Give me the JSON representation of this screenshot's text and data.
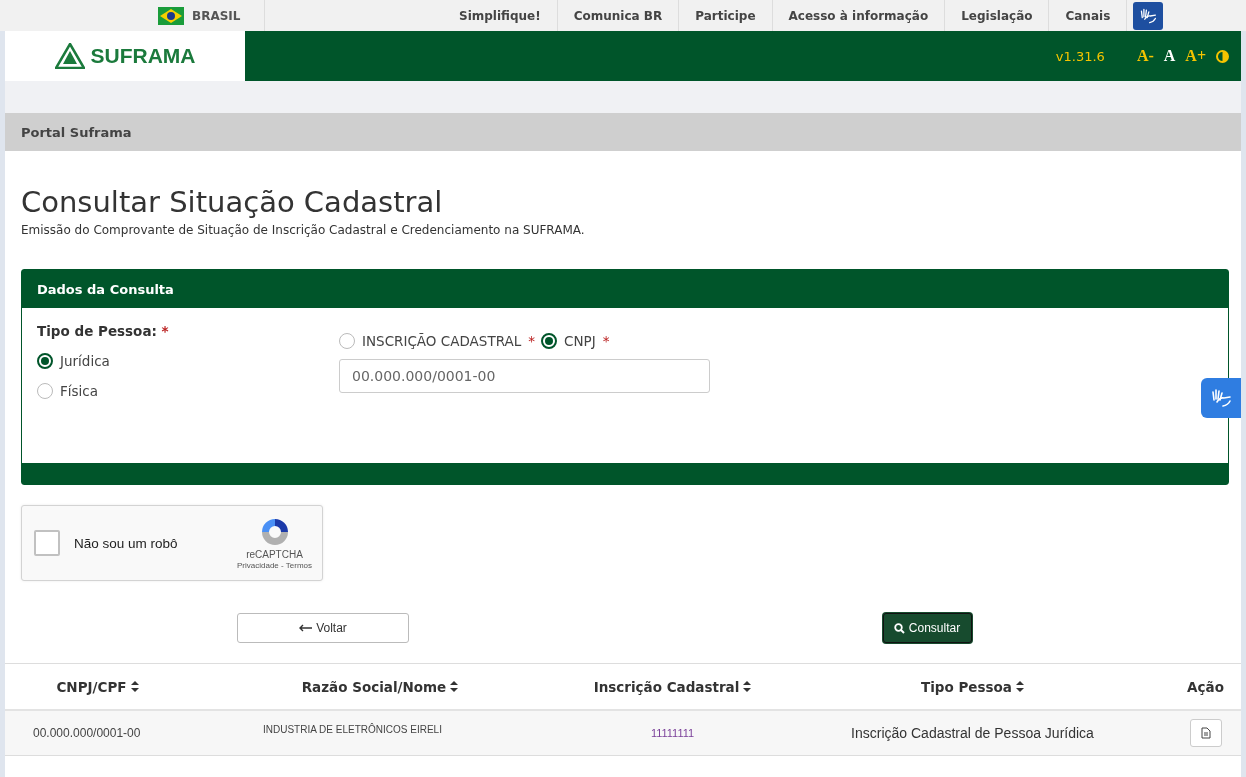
{
  "top_bar": {
    "country": "BRASIL",
    "links": [
      "Simplifique!",
      "Comunica BR",
      "Participe",
      "Acesso à informação",
      "Legislação",
      "Canais"
    ]
  },
  "header": {
    "logo": "SUFRAMA",
    "version": "v1.31.6",
    "font_controls": [
      "A-",
      "A",
      "A+"
    ]
  },
  "breadcrumb": "Portal Suframa",
  "page": {
    "title": "Consultar Situação Cadastral",
    "subtitle": "Emissão do Comprovante de Situação de Inscrição Cadastral e Credenciamento na SUFRAMA."
  },
  "form": {
    "title": "Dados da Consulta",
    "person_label": "Tipo de Pessoa:",
    "required_mark": "*",
    "person_types": [
      {
        "label": "Jurídica",
        "selected": true
      },
      {
        "label": "Física",
        "selected": false
      }
    ],
    "search_types": [
      {
        "label": "INSCRIÇÃO CADASTRAL",
        "required_mark": "*",
        "selected": false
      },
      {
        "label": "CNPJ",
        "required_mark": "*",
        "selected": true
      }
    ],
    "field": {
      "placeholder": "00.000.000/0001-00"
    }
  },
  "captcha": {
    "checked": false,
    "label": "Não sou um robô",
    "brand": "reCAPTCHA",
    "links": "Privacidade - Termos"
  },
  "buttons": [
    {
      "kind": "back",
      "label": "Voltar"
    },
    {
      "kind": "search",
      "label": "Consultar"
    }
  ],
  "table": {
    "columns": [
      {
        "label": "CNPJ/CPF",
        "sortable": true
      },
      {
        "label": "Razão Social/Nome",
        "sortable": true
      },
      {
        "label": "Inscrição Cadastral",
        "sortable": true
      },
      {
        "label": "Tipo Pessoa",
        "sortable": true
      },
      {
        "label": "Ação",
        "sortable": false
      }
    ],
    "rows": [
      {
        "cnpj": "00.000.000/0001-00",
        "name": "INDUSTRIA DE ELETRÔNICOS EIRELI",
        "inscricao": "11111111",
        "tipo": "Inscrição Cadastral de Pessoa Jurídica"
      }
    ]
  }
}
